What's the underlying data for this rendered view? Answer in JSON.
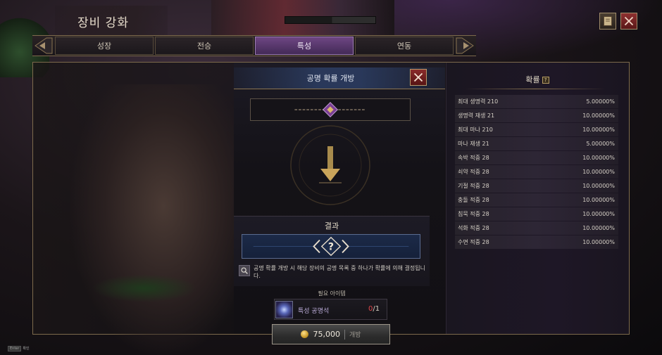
{
  "header": {
    "title": "장비 강화"
  },
  "tabs": [
    {
      "label": "성장",
      "active": false
    },
    {
      "label": "전승",
      "active": false
    },
    {
      "label": "특성",
      "active": true
    },
    {
      "label": "연동",
      "active": false
    }
  ],
  "center": {
    "title": "공명 확률 개방",
    "result_title": "결과",
    "result_symbol": "?",
    "info_text": "공명 확률 개방 시 해당 장비의 공명 목록 중 하나가 확률에 의해 결정됩니다.",
    "required_label": "필요 아이템",
    "item": {
      "name": "특성 공명석",
      "have": "0",
      "need": "/1"
    },
    "open_button": {
      "price": "75,000",
      "label": "개방"
    }
  },
  "probability": {
    "title": "확률",
    "help": "?",
    "rows": [
      {
        "name": "최대 생명력  210",
        "value": "5.00000%"
      },
      {
        "name": "생명력 재생  21",
        "value": "10.00000%"
      },
      {
        "name": "최대 마나  210",
        "value": "10.00000%"
      },
      {
        "name": "마나 재생  21",
        "value": "5.00000%"
      },
      {
        "name": "속박 적중  28",
        "value": "10.00000%"
      },
      {
        "name": "쇠약 적중  28",
        "value": "10.00000%"
      },
      {
        "name": "기절 적중  28",
        "value": "10.00000%"
      },
      {
        "name": "충돌 적중  28",
        "value": "10.00000%"
      },
      {
        "name": "침묵 적중  28",
        "value": "10.00000%"
      },
      {
        "name": "석화 적중  28",
        "value": "10.00000%"
      },
      {
        "name": "수면 적중  28",
        "value": "10.00000%"
      }
    ]
  },
  "footer": {
    "key": "Enter",
    "label": "확인"
  },
  "colors": {
    "accent": "#6e4683",
    "gold": "#8a7451",
    "danger": "#e3484b",
    "close": "#8e3030"
  },
  "icons": [
    "book-icon",
    "close-icon",
    "chain-icon",
    "down-arrow-icon",
    "question-icon",
    "magnifier-icon",
    "gem-icon",
    "coin-icon"
  ]
}
